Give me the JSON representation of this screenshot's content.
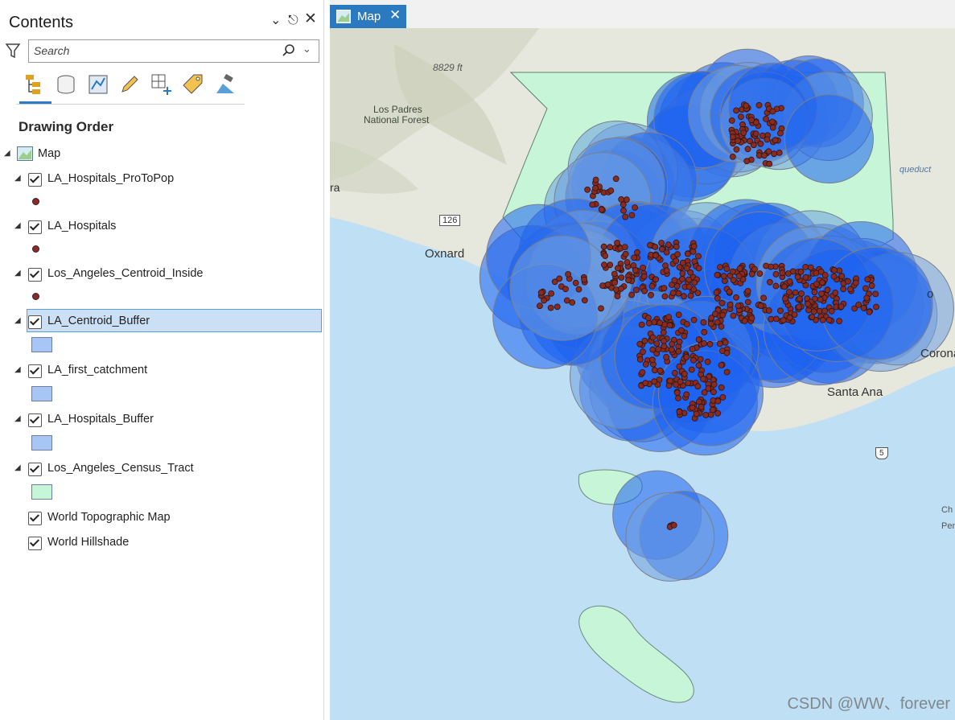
{
  "contents_pane": {
    "title": "Contents",
    "search": {
      "placeholder": "Search",
      "value": ""
    },
    "toolbar": {
      "items": [
        "list-by-drawing-order",
        "list-by-data-source",
        "list-by-selection",
        "list-by-editing",
        "list-by-snapping",
        "list-by-labeling",
        "list-by-perspective-imagery"
      ],
      "active": "list-by-drawing-order"
    },
    "section_heading": "Drawing Order",
    "map_node": "Map",
    "layers": [
      {
        "name": "LA_Hospitals_ProToPop",
        "symbol": "point",
        "color": "#8b2a2a",
        "checked": true
      },
      {
        "name": "LA_Hospitals",
        "symbol": "point",
        "color": "#8b2a2a",
        "checked": true
      },
      {
        "name": "Los_Angeles_Centroid_Inside",
        "symbol": "point",
        "color": "#8b2a2a",
        "checked": true
      },
      {
        "name": "LA_Centroid_Buffer",
        "symbol": "polygon",
        "color": "#a7c6f5",
        "checked": true,
        "selected": true
      },
      {
        "name": "LA_first_catchment",
        "symbol": "polygon",
        "color": "#a7c6f5",
        "checked": true
      },
      {
        "name": "LA_Hospitals_Buffer",
        "symbol": "polygon",
        "color": "#a7c6f5",
        "checked": true
      },
      {
        "name": "Los_Angeles_Census_Tract",
        "symbol": "polygon",
        "color": "#c6f5d8",
        "checked": true
      },
      {
        "name": "World Topographic Map",
        "checked": true
      },
      {
        "name": "World Hillshade",
        "checked": true
      }
    ]
  },
  "map_view": {
    "tab_label": "Map",
    "labels": {
      "elevation": "8829 ft",
      "forest_1": "Los Padres",
      "forest_2": "National Forest",
      "city_fragment_left": "ra",
      "highway": "126",
      "oxnard": "Oxnard",
      "santa_ana": "Santa Ana",
      "corona": "Corona",
      "city_fragment_right": "o",
      "aqueduct": "queduct",
      "interstate": "5",
      "edge_fragment_1": "Ch",
      "edge_fragment_2": "Pen"
    },
    "colors": {
      "ocean": "#bfe0f4",
      "land": "#e7e8df",
      "county": "#c6f5d8",
      "buffer_dense": "#1d63f0",
      "buffer_light": "#6f9ee0",
      "point_fill": "#8b2a1f"
    }
  },
  "watermark": "CSDN @WW、forever"
}
